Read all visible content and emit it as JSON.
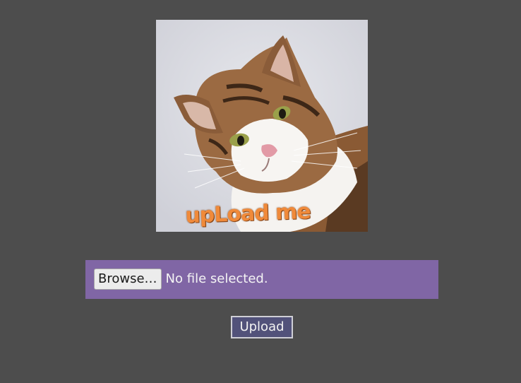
{
  "hero": {
    "caption": "upLoad me",
    "image": "cat-photo"
  },
  "file_input": {
    "browse_label": "Browse…",
    "status": "No file selected."
  },
  "upload": {
    "label": "Upload"
  },
  "colors": {
    "background": "#4d4d4d",
    "file_bar": "#8066a5",
    "upload_button": "#52527a",
    "caption": "#f08a3a"
  }
}
